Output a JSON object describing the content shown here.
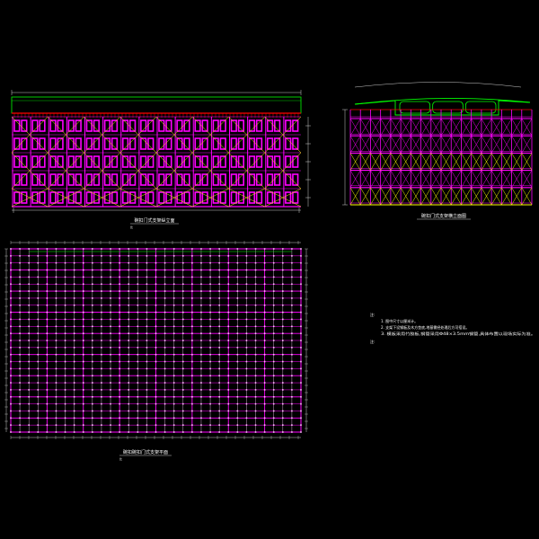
{
  "drawing": {
    "background": "#000000",
    "colors": {
      "frame": "#ff00ff",
      "brace": "#ffff00",
      "deck": "#00ff00",
      "rail": "#ff0000",
      "dimension": "#ffffff",
      "plan_light": "#ffc0ff"
    },
    "elevation": {
      "caption": "碗扣门式支架纵立面",
      "sub_mark": "比",
      "bays": 16,
      "tiers": 5
    },
    "cross_section": {
      "caption": "碗扣门式支架横立面图",
      "bays": 18,
      "tiers": 5,
      "box_cells": 3
    },
    "plan": {
      "caption": "碗扣碗扣门式支架平面",
      "sub_mark": "比",
      "columns": 32,
      "rows": 26
    },
    "notes": {
      "heading": "注:",
      "lines": [
        "1. 图中尺寸以厘米计。",
        "2. 支架下设钢板及木方垫底,地基需经处理后方可搭设。",
        "3. 模板采用竹胶板,钢管采用Φ48×3.5mm钢管,具体布置以现场实际为准。"
      ],
      "footer": "注:"
    }
  }
}
